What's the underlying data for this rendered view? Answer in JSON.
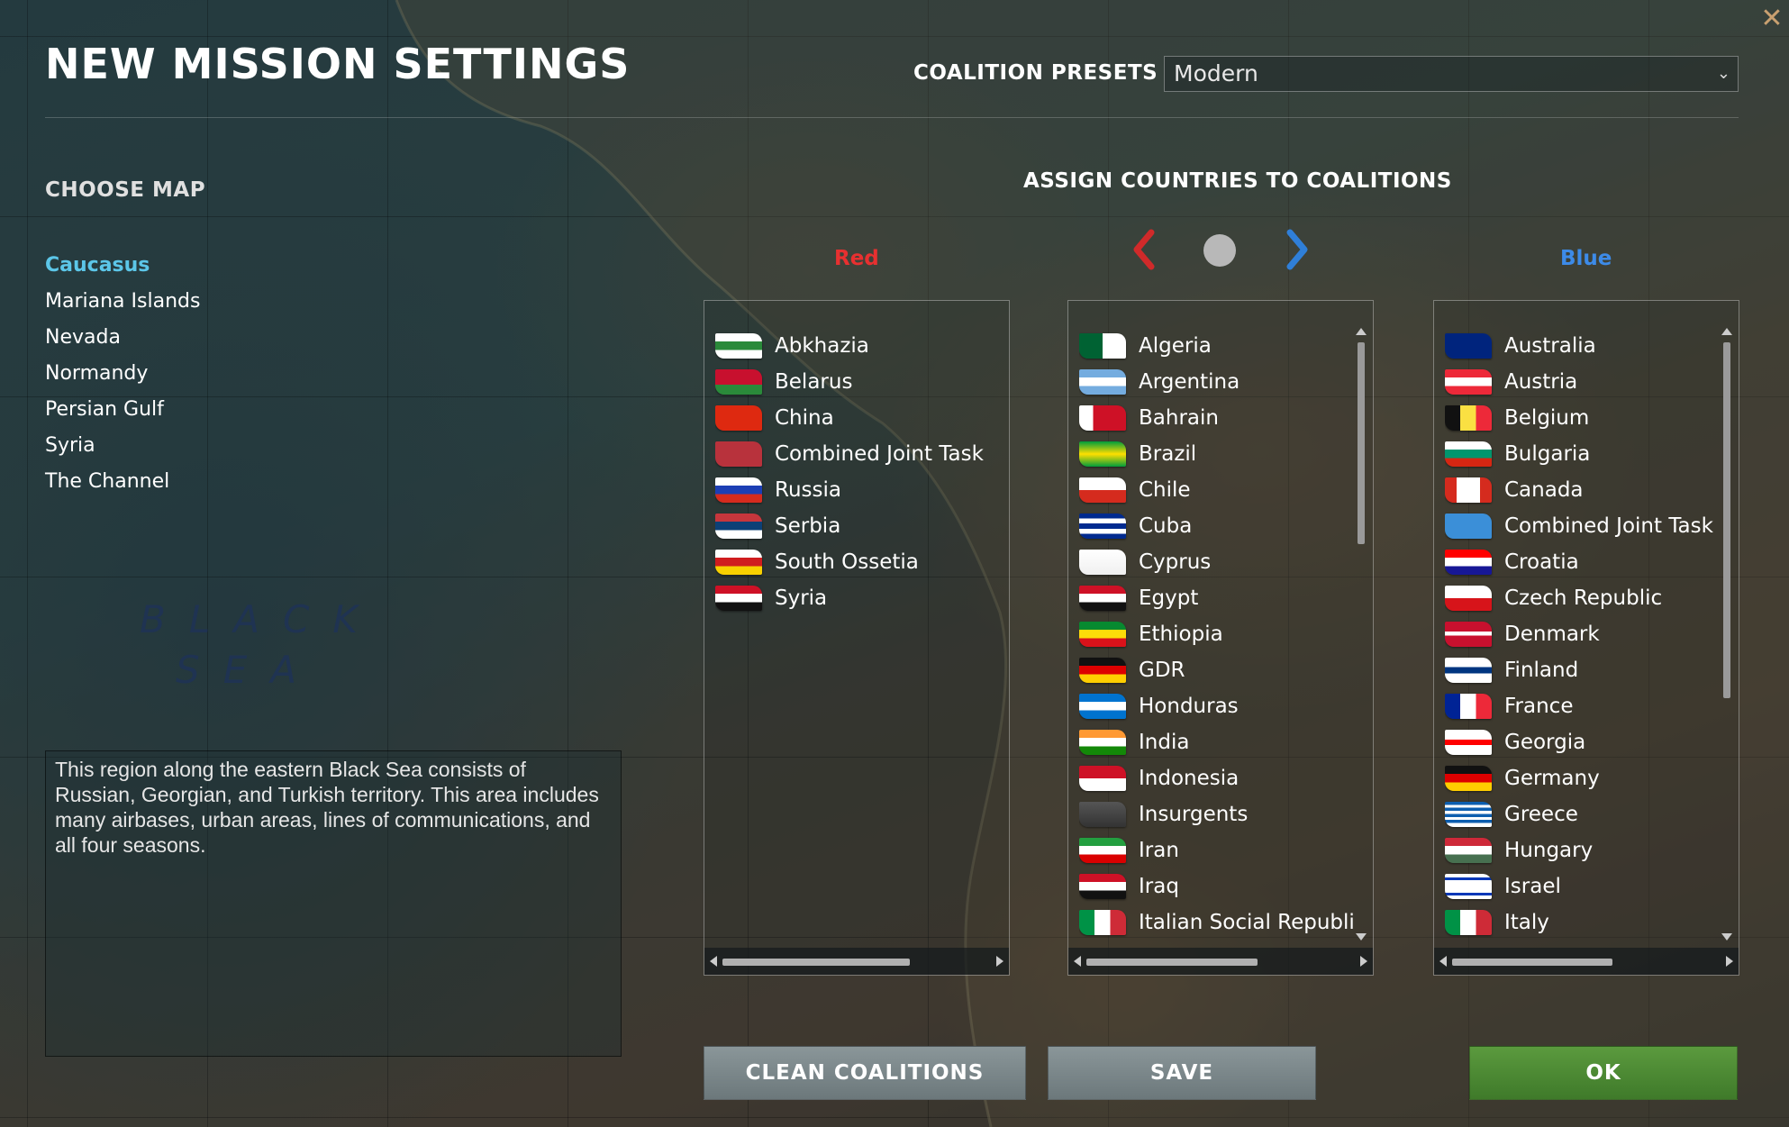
{
  "header": {
    "title": "NEW MISSION SETTINGS",
    "presets_label": "COALITION PRESETS",
    "presets_value": "Modern"
  },
  "maps": {
    "heading": "CHOOSE MAP",
    "items": [
      "Caucasus",
      "Mariana Islands",
      "Nevada",
      "Normandy",
      "Persian Gulf",
      "Syria",
      "The Channel"
    ],
    "selected": "Caucasus",
    "sea_label": "BLACK SEA",
    "description": "This region along the eastern Black Sea consists of Russian, Georgian, and Turkish territory. This area includes many airbases, urban areas, lines of communications, and all four seasons."
  },
  "coalitions": {
    "heading": "ASSIGN COUNTRIES TO COALITIONS",
    "red_label": "Red",
    "blue_label": "Blue",
    "colors": {
      "red": "#e83030",
      "blue": "#3d8be8"
    },
    "red": [
      "Abkhazia",
      "Belarus",
      "China",
      "Combined Joint Task Forces Red",
      "Russia",
      "Serbia",
      "South Ossetia",
      "Syria"
    ],
    "neutral": [
      "Algeria",
      "Argentina",
      "Bahrain",
      "Brazil",
      "Chile",
      "Cuba",
      "Cyprus",
      "Egypt",
      "Ethiopia",
      "GDR",
      "Honduras",
      "India",
      "Indonesia",
      "Insurgents",
      "Iran",
      "Iraq",
      "Italian Social Republic"
    ],
    "blue": [
      "Australia",
      "Austria",
      "Belgium",
      "Bulgaria",
      "Canada",
      "Combined Joint Task Forces Blue",
      "Croatia",
      "Czech Republic",
      "Denmark",
      "Finland",
      "France",
      "Georgia",
      "Germany",
      "Greece",
      "Hungary",
      "Israel",
      "Italy"
    ]
  },
  "buttons": {
    "clean": "CLEAN COALITIONS",
    "save": "SAVE",
    "ok": "OK"
  }
}
